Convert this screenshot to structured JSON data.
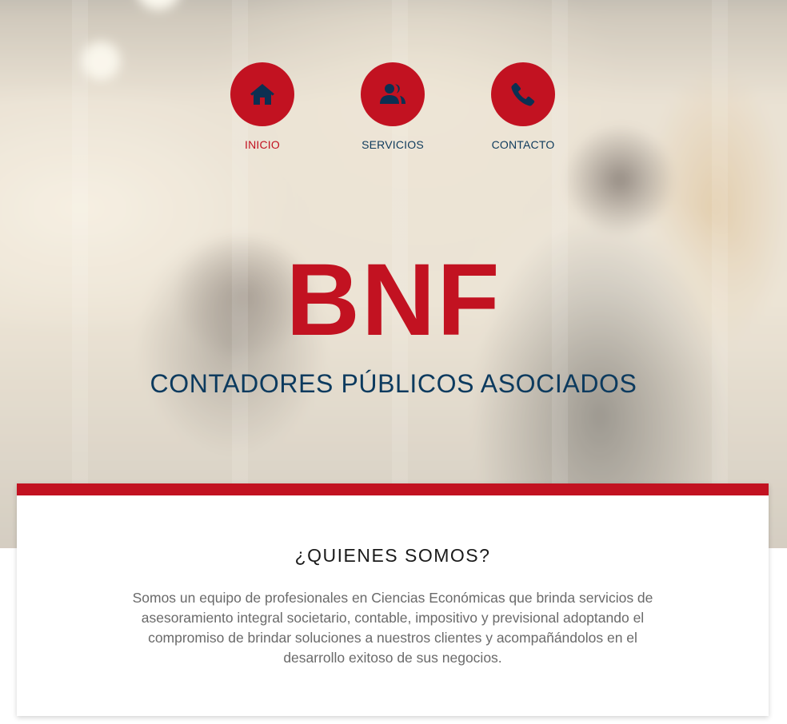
{
  "nav": {
    "items": [
      {
        "label": "INICIO",
        "icon": "home-icon",
        "active": true
      },
      {
        "label": "SERVICIOS",
        "icon": "users-icon",
        "active": false
      },
      {
        "label": "CONTACTO",
        "icon": "phone-icon",
        "active": false
      }
    ]
  },
  "hero": {
    "title": "BNF",
    "subtitle": "CONTADORES PÚBLICOS ASOCIADOS"
  },
  "about": {
    "title": "¿QUIENES SOMOS?",
    "text": "Somos un equipo de profesionales en Ciencias Económicas que brinda servicios de asesoramiento integral societario, contable, impositivo y previsional adoptando el compromiso de brindar soluciones a nuestros clientes y acompañándolos en el desarrollo exitoso de sus negocios."
  },
  "colors": {
    "accent_red": "#c21221",
    "navy": "#0c3a5e",
    "card_background": "#ffffff",
    "body_text": "#6a6a6a"
  }
}
